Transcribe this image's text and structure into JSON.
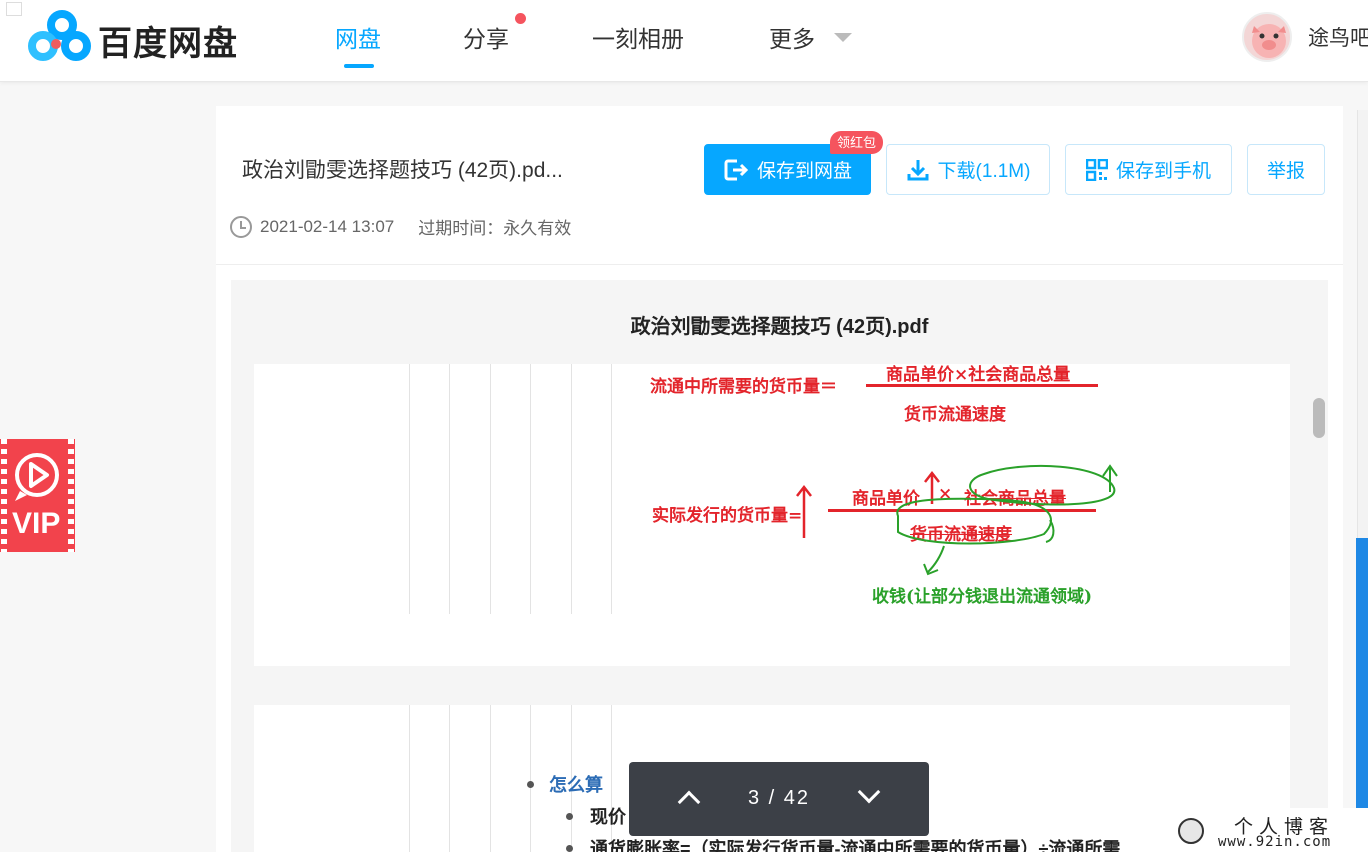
{
  "header": {
    "brand": "百度网盘",
    "nav": [
      {
        "label": "网盘"
      },
      {
        "label": "分享"
      },
      {
        "label": "一刻相册"
      },
      {
        "label": "更多"
      }
    ],
    "username": "途鸟吧"
  },
  "sidebar": {
    "vip_label": "VIP"
  },
  "file": {
    "title": "政治刘勖雯选择题技巧 (42页).pd...",
    "date": "2021-02-14 13:07",
    "expire": "过期时间：永久有效"
  },
  "actions": {
    "save_cloud": "保存到网盘",
    "redpack": "领红包",
    "download": "下载(1.1M)",
    "save_phone": "保存到手机",
    "report": "举报"
  },
  "preview": {
    "title": "政治刘勖雯选择题技巧 (42页).pdf",
    "page1": {
      "formula1_left": "流通中所需要的货币量＝",
      "formula1_num": "商品单价×社会商品总量",
      "formula1_den": "货币流通速度",
      "formula2_left": "实际发行的货币量=",
      "formula2_num_a": "商品单价",
      "formula2_times": "×",
      "formula2_num_b": "社会商品总量",
      "formula2_den": "货币流通速度",
      "note": "收钱(让部分钱退出流通领域)"
    },
    "page2": {
      "heading": "怎么算",
      "item1": "现价",
      "item2": "通货膨胀率=（实际发行货币量-流通中所需要的货币量）÷流通所需"
    }
  },
  "pager": {
    "current": "3",
    "separator": "/",
    "total": "42"
  },
  "watermark": {
    "line1": "个人博客",
    "line2": "www.92in.com"
  },
  "colors": {
    "accent": "#06a7ff",
    "red": "#e3242b",
    "green": "#2aa12a",
    "badge": "#f5545e"
  }
}
